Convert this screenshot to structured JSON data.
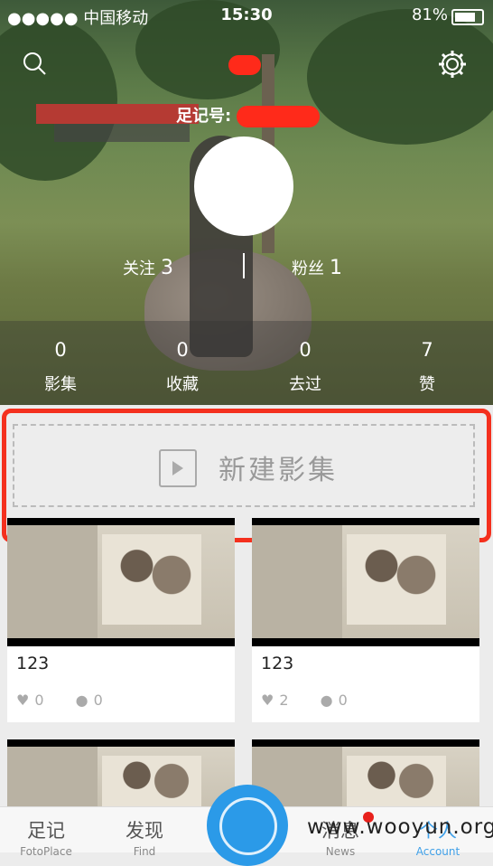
{
  "status_bar": {
    "carrier": "●●●●● 中国移动",
    "time": "15:30",
    "battery": "81%"
  },
  "profile": {
    "id_label": "足记号:",
    "following_label": "关注",
    "following_count": "3",
    "followers_label": "粉丝",
    "followers_count": "1"
  },
  "stats": [
    {
      "value": "0",
      "label": "影集"
    },
    {
      "value": "0",
      "label": "收藏"
    },
    {
      "value": "0",
      "label": "去过"
    },
    {
      "value": "7",
      "label": "赞"
    }
  ],
  "new_album": {
    "label": "新建影集"
  },
  "albums": [
    {
      "title": "123",
      "likes": "0",
      "comments": "0"
    },
    {
      "title": "123",
      "likes": "2",
      "comments": "0"
    }
  ],
  "tabs": [
    {
      "zh": "足记",
      "en": "FotoPlace"
    },
    {
      "zh": "发现",
      "en": "Find"
    },
    {
      "zh": "消息",
      "en": "News"
    },
    {
      "zh": "个人",
      "en": "Account"
    }
  ],
  "watermark": "www.wooyun.org",
  "colors": {
    "accent": "#3fa0e8",
    "highlight": "#f4301e",
    "redact": "#ff2a1a"
  }
}
